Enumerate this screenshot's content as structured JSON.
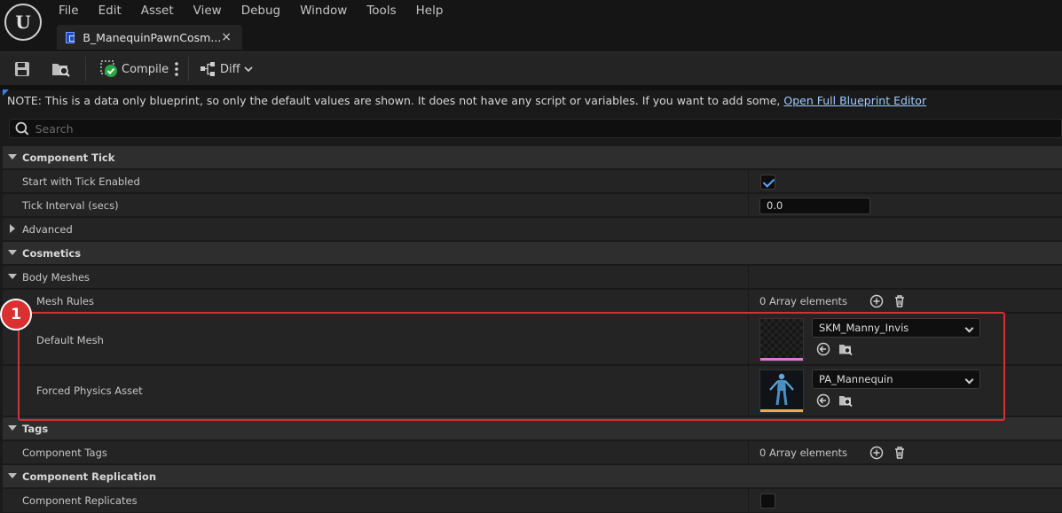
{
  "app": {
    "logo_text": "U"
  },
  "menu": [
    "File",
    "Edit",
    "Asset",
    "View",
    "Debug",
    "Window",
    "Tools",
    "Help"
  ],
  "tab": {
    "label": "B_ManequinPawnCosm...",
    "close": "×"
  },
  "toolbar": {
    "compile_label": "Compile",
    "diff_label": "Diff"
  },
  "note": {
    "text": "NOTE: This is a data only blueprint, so only the default values are shown.  It does not have any script or variables.  If you want to add some,",
    "link": "Open Full Blueprint Editor"
  },
  "search": {
    "placeholder": "Search"
  },
  "categories": {
    "component_tick": "Component Tick",
    "cosmetics": "Cosmetics",
    "tags": "Tags",
    "component_replication": "Component Replication"
  },
  "properties": {
    "start_with_tick": {
      "label": "Start with Tick Enabled",
      "checked": true
    },
    "tick_interval": {
      "label": "Tick Interval (secs)",
      "value": "0.0"
    },
    "advanced": {
      "label": "Advanced"
    },
    "body_meshes": {
      "label": "Body Meshes"
    },
    "mesh_rules": {
      "label": "Mesh Rules",
      "value": "0 Array elements"
    },
    "default_mesh": {
      "label": "Default Mesh",
      "value": "SKM_Manny_Invis",
      "accent": "#e07ad8"
    },
    "forced_physics": {
      "label": "Forced Physics Asset",
      "value": "PA_Mannequin",
      "accent": "#f0a850"
    },
    "component_tags": {
      "label": "Component Tags",
      "value": "0 Array elements"
    },
    "component_replicates": {
      "label": "Component Replicates",
      "checked": false
    }
  },
  "annotation": {
    "number": "1",
    "color": "#dc3030"
  }
}
